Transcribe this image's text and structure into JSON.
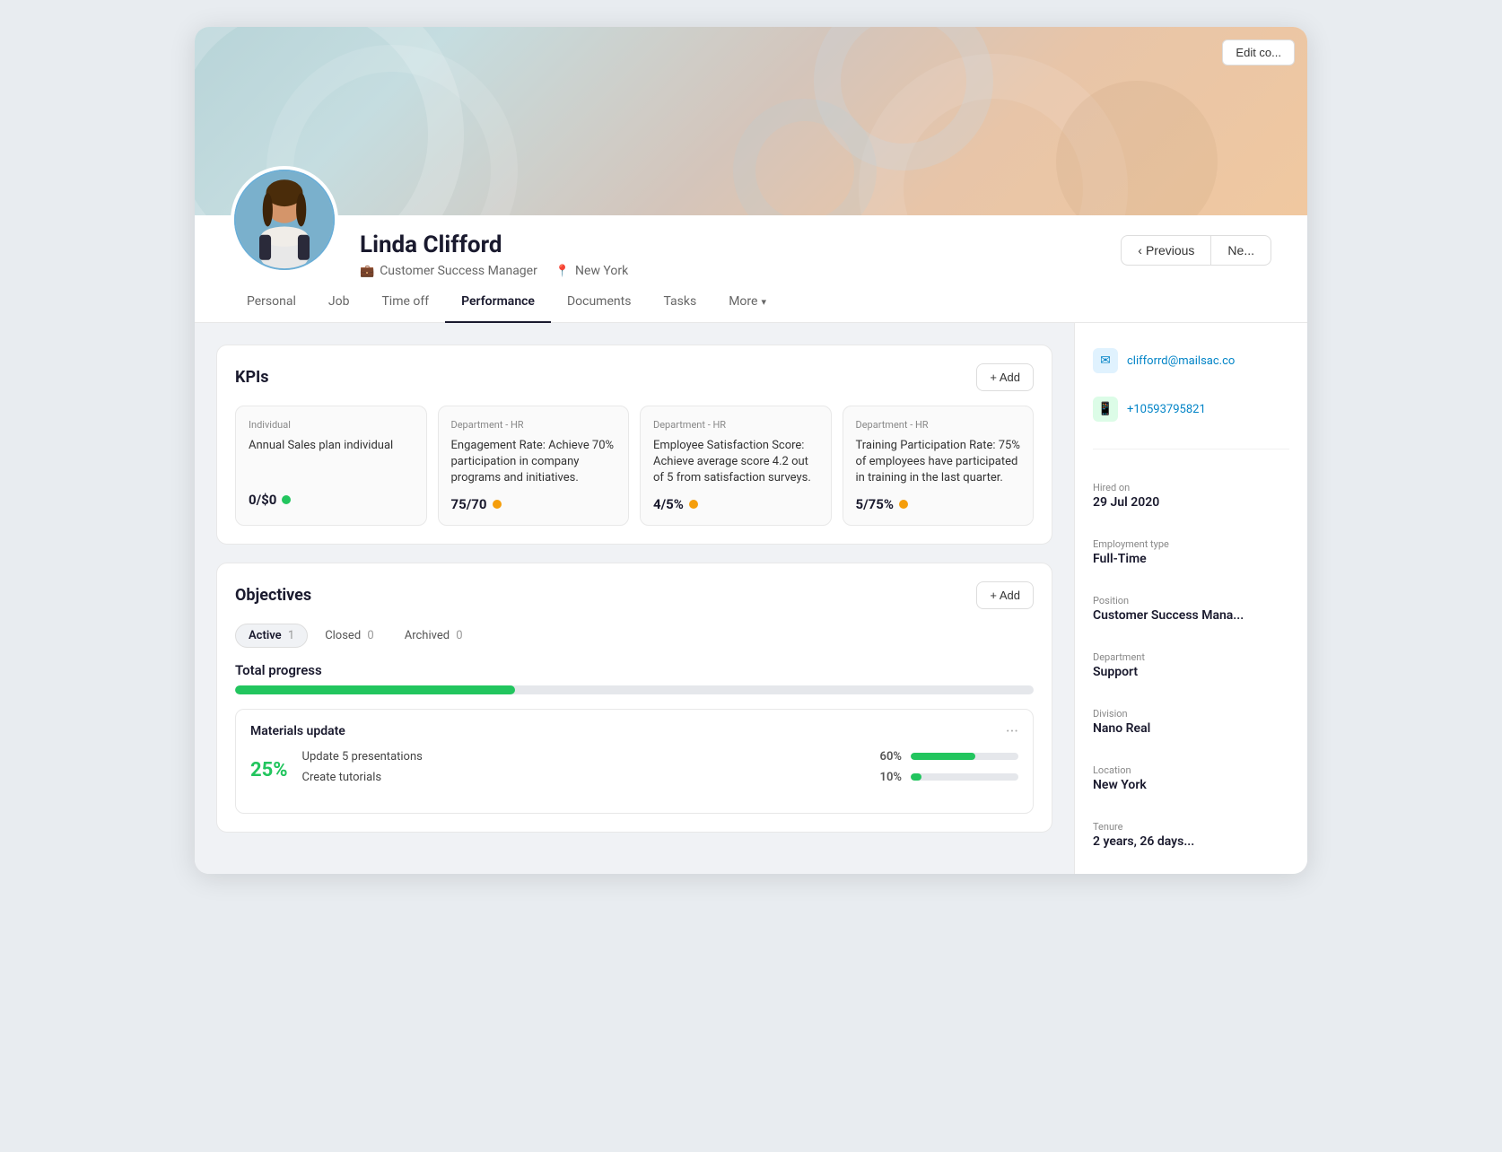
{
  "page": {
    "edit_cover_label": "Edit co...",
    "prev_label": "Previous",
    "next_label": "Ne..."
  },
  "profile": {
    "name": "Linda Clifford",
    "title": "Customer Success Manager",
    "location": "New York"
  },
  "tabs": [
    {
      "id": "personal",
      "label": "Personal",
      "active": false
    },
    {
      "id": "job",
      "label": "Job",
      "active": false
    },
    {
      "id": "timeoff",
      "label": "Time off",
      "active": false
    },
    {
      "id": "performance",
      "label": "Performance",
      "active": true
    },
    {
      "id": "documents",
      "label": "Documents",
      "active": false
    },
    {
      "id": "tasks",
      "label": "Tasks",
      "active": false
    },
    {
      "id": "more",
      "label": "More",
      "active": false
    }
  ],
  "kpis": {
    "section_title": "KPIs",
    "add_label": "+ Add",
    "cards": [
      {
        "category": "Individual",
        "description": "Annual Sales plan individual",
        "value": "0/$0",
        "status": "green"
      },
      {
        "category": "Department - HR",
        "description": "Engagement Rate: Achieve 70% participation in company programs and initiatives.",
        "value": "75/70",
        "status": "yellow"
      },
      {
        "category": "Department - HR",
        "description": "Employee Satisfaction Score: Achieve average score 4.2 out of 5 from satisfaction surveys.",
        "value": "4/5%",
        "status": "yellow"
      },
      {
        "category": "Department - HR",
        "description": "Training Participation Rate: 75% of employees have participated in training in the last quarter.",
        "value": "5/75%",
        "status": "yellow"
      }
    ]
  },
  "objectives": {
    "section_title": "Objectives",
    "add_label": "+ Add",
    "tabs": [
      {
        "label": "Active",
        "count": "1",
        "active": true
      },
      {
        "label": "Closed",
        "count": "0",
        "active": false
      },
      {
        "label": "Archived",
        "count": "0",
        "active": false
      }
    ],
    "total_progress_label": "Total progress",
    "progress_pct": 35,
    "materials": {
      "title": "Materials update",
      "overall_pct": "25%",
      "tasks": [
        {
          "label": "Update 5 presentations",
          "pct": 60,
          "pct_label": "60%"
        },
        {
          "label": "Create tutorials",
          "pct": 10,
          "pct_label": "10%"
        }
      ]
    }
  },
  "sidebar": {
    "email": "clifforrd@mailsac.co",
    "phone": "+10593795821",
    "hired_on_label": "Hired on",
    "hired_on_value": "29 Jul 2020",
    "employment_type_label": "Employment type",
    "employment_type_value": "Full-Time",
    "position_label": "Position",
    "position_value": "Customer Success Mana...",
    "department_label": "Department",
    "department_value": "Support",
    "division_label": "Division",
    "division_value": "Nano Real",
    "location_label": "Location",
    "location_value": "New York",
    "tenure_label": "Tenure",
    "tenure_value": "2 years, 26 days..."
  }
}
